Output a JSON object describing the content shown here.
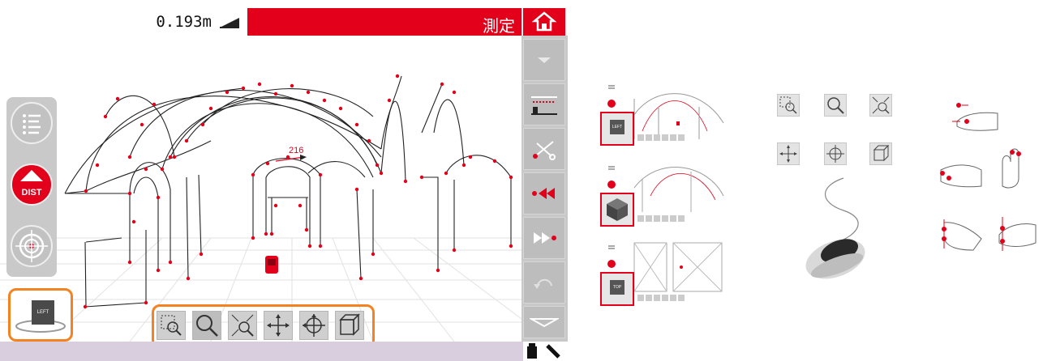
{
  "topbar": {
    "distance_readout": "0.193m",
    "mode_label": "測定",
    "slope_icon": "slope-wedge-icon",
    "home_icon": "home-icon"
  },
  "left_toolbar": {
    "menu_icon": "list-menu-icon",
    "dist_label": "DIST",
    "target_icon": "target-icon"
  },
  "viewcube": {
    "face_label": "LEFT"
  },
  "measurement": {
    "label": "216"
  },
  "right_toolbar": {
    "items": [
      "scroll-up-icon",
      "height-profile-icon",
      "scissors-icon",
      "rewind-icon",
      "forward-icon",
      "undo-icon",
      "scroll-down-icon"
    ]
  },
  "nav_tools": [
    "zoom-window-icon",
    "zoom-icon",
    "zoom-extents-icon",
    "pan-icon",
    "orbit-icon",
    "box-view-icon"
  ],
  "status_icons": [
    "device-icon",
    "pen-icon"
  ],
  "colors": {
    "accent": "#e2001a",
    "highlight": "#f58220",
    "toolbar": "#c8c8c8",
    "status_bar": "#d8cede"
  },
  "thumbnails": {
    "items": [
      {
        "cube_label": "LEFT"
      },
      {
        "cube_label": ""
      },
      {
        "cube_label": "TOP"
      }
    ]
  },
  "help_tools": [
    "zoom-window-icon",
    "zoom-icon",
    "zoom-extents-icon",
    "pan-icon",
    "orbit-icon",
    "box-view-icon"
  ]
}
